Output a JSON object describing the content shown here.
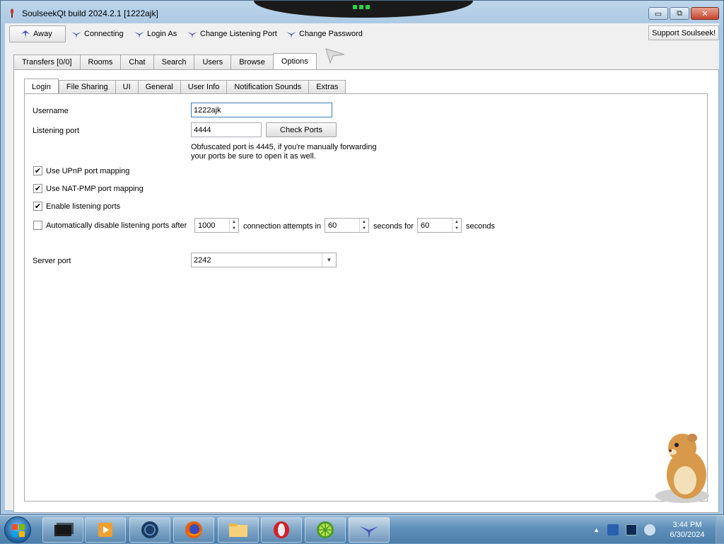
{
  "window": {
    "title": "SoulseekQt build 2024.2.1 [1222ajk]"
  },
  "window_controls": {
    "minimize": "▭",
    "maximize": "⧉",
    "close": "✕"
  },
  "toolbar": {
    "away": "Away",
    "connecting": "Connecting",
    "login_as": "Login As",
    "change_listening_port": "Change Listening Port",
    "change_password": "Change Password",
    "support": "Support Soulseek!"
  },
  "main_tabs": [
    "Transfers [0/0]",
    "Rooms",
    "Chat",
    "Search",
    "Users",
    "Browse",
    "Options"
  ],
  "sub_tabs": [
    "Login",
    "File Sharing",
    "UI",
    "General",
    "User Info",
    "Notification Sounds",
    "Extras"
  ],
  "login": {
    "username_label": "Username",
    "username_value": "1222ajk",
    "listening_port_label": "Listening port",
    "listening_port_value": "4444",
    "check_ports": "Check Ports",
    "obfuscated_note_1": "Obfuscated port is 4445, if you're manually forwarding",
    "obfuscated_note_2": "your ports be sure to open it as well.",
    "upnp_label": "Use UPnP port mapping",
    "natpmp_label": "Use NAT-PMP port mapping",
    "enable_ports_label": "Enable listening ports",
    "auto_disable_label": "Automatically disable listening ports after",
    "attempts_value": "1000",
    "connection_attempts_label": "connection attempts in",
    "seconds_value": "60",
    "seconds_for_label": "seconds for",
    "for_value": "60",
    "seconds_label": "seconds",
    "server_port_label": "Server port",
    "server_port_value": "2242",
    "checked": {
      "upnp": true,
      "natpmp": true,
      "enable_ports": true,
      "auto_disable": false
    }
  },
  "check_mark": "✔",
  "taskbar": {
    "tray_arrow": "▲",
    "time": "3:44 PM",
    "date": "6/30/2024"
  },
  "colors": {
    "accent": "#3c7fb1",
    "taskbar": "#5f8fb9"
  }
}
